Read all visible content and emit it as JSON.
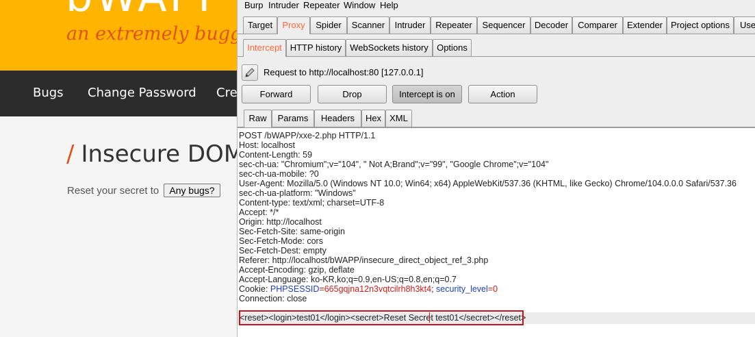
{
  "bwapp": {
    "logo": "bWAPP",
    "tagline": "an extremely buggy web app !",
    "nav": [
      "Bugs",
      "Change Password",
      "Create User"
    ],
    "page_title_slash": "/",
    "page_title": "Insecure DOM - Reset Secret",
    "reset_label": "Reset your secret to",
    "reset_button": "Any bugs?"
  },
  "burp": {
    "menu": [
      "Burp",
      "Intruder",
      "Repeater",
      "Window",
      "Help"
    ],
    "main_tabs": [
      "Target",
      "Proxy",
      "Spider",
      "Scanner",
      "Intruder",
      "Repeater",
      "Sequencer",
      "Decoder",
      "Comparer",
      "Extender",
      "Project options",
      "User options"
    ],
    "main_tab_active": "Proxy",
    "proxy_tabs": [
      "Intercept",
      "HTTP history",
      "WebSockets history",
      "Options"
    ],
    "proxy_tab_active": "Intercept",
    "request_info": "Request to http://localhost:80  [127.0.0.1]",
    "buttons": {
      "forward": "Forward",
      "drop": "Drop",
      "intercept": "Intercept is on",
      "action": "Action"
    },
    "view_tabs": [
      "Raw",
      "Params",
      "Headers",
      "Hex",
      "XML"
    ],
    "view_tab_active": "Raw",
    "request_lines": [
      "POST /bWAPP/xxe-2.php HTTP/1.1",
      "Host: localhost",
      "Content-Length: 59",
      "sec-ch-ua: \"Chromium\";v=\"104\", \" Not A;Brand\";v=\"99\", \"Google Chrome\";v=\"104\"",
      "sec-ch-ua-mobile: ?0",
      "User-Agent: Mozilla/5.0 (Windows NT 10.0; Win64; x64) AppleWebKit/537.36 (KHTML, like Gecko) Chrome/104.0.0.0 Safari/537.36",
      "sec-ch-ua-platform: \"Windows\"",
      "Content-type: text/xml; charset=UTF-8",
      "Accept: */*",
      "Origin: http://localhost",
      "Sec-Fetch-Site: same-origin",
      "Sec-Fetch-Mode: cors",
      "Sec-Fetch-Dest: empty",
      "Referer: http://localhost/bWAPP/insecure_direct_object_ref_3.php",
      "Accept-Encoding: gzip, deflate",
      "Accept-Language: ko-KR,ko;q=0.9,en-US;q=0.8,en;q=0.7"
    ],
    "cookie": {
      "label": "Cookie: ",
      "phpsessid_name": "PHPSESSID",
      "phpsessid_value": "=665gqjna12n3vqtcilrh8h3kt4",
      "sep": "; ",
      "security_name": "security_level",
      "security_value": "=0"
    },
    "connection": "Connection: close",
    "body": "<reset><login>test01</login><secret>Reset Secret test01</secret></reset>"
  },
  "colors": {
    "bwapp_orange": "#ffb500",
    "bwapp_accent": "#e0531a",
    "burp_active_tab": "#ff6633",
    "highlight_box": "#d0101a"
  }
}
